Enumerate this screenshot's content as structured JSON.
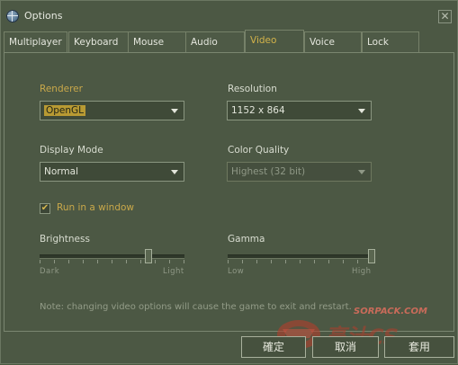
{
  "window": {
    "title": "Options",
    "close_label": "✕"
  },
  "tabs": [
    {
      "label": "Multiplayer"
    },
    {
      "label": "Keyboard"
    },
    {
      "label": "Mouse"
    },
    {
      "label": "Audio"
    },
    {
      "label": "Video",
      "active": true
    },
    {
      "label": "Voice"
    },
    {
      "label": "Lock"
    }
  ],
  "video": {
    "renderer": {
      "label": "Renderer",
      "value": "OpenGL"
    },
    "resolution": {
      "label": "Resolution",
      "value": "1152 x 864"
    },
    "display_mode": {
      "label": "Display Mode",
      "value": "Normal"
    },
    "color_quality": {
      "label": "Color Quality",
      "value": "Highest (32 bit)",
      "enabled": false
    },
    "run_in_window": {
      "label": "Run in a window",
      "checked": true,
      "check_glyph": "✔"
    },
    "brightness": {
      "label": "Brightness",
      "min_label": "Dark",
      "max_label": "Light",
      "level": 0.75
    },
    "gamma": {
      "label": "Gamma",
      "min_label": "Low",
      "max_label": "High",
      "level": 1.0
    },
    "note": "Note: changing video options will cause the game to exit and restart."
  },
  "buttons": {
    "ok": "確定",
    "cancel": "取消",
    "apply": "套用"
  },
  "watermark": {
    "url": "SORPACK.COM",
    "logo_text": "烹汁CS"
  },
  "colors": {
    "accent": "#c9a84a",
    "panel": "#4c5844",
    "watermark": "#b23d2c"
  }
}
